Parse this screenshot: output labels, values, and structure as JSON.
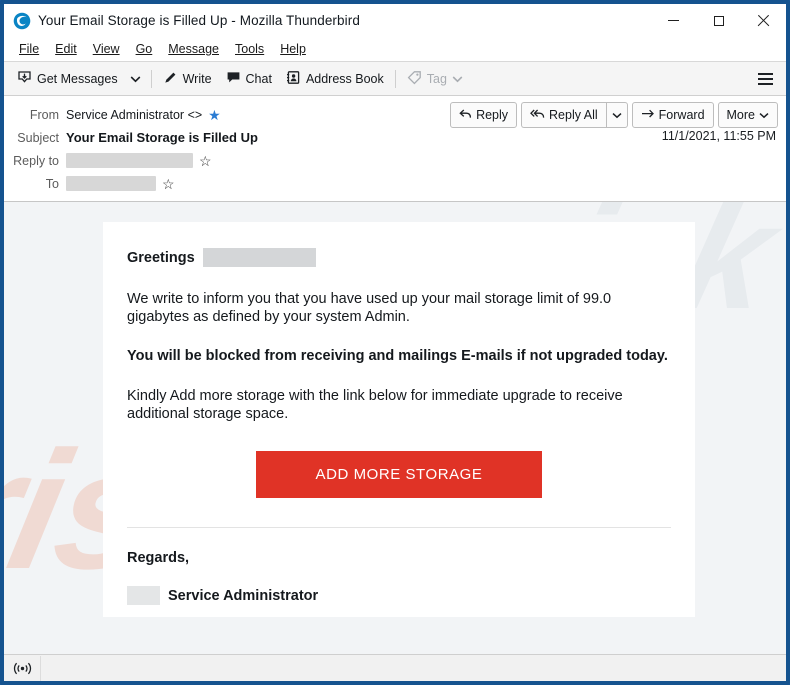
{
  "window": {
    "title": "Your Email Storage is Filled Up - Mozilla Thunderbird",
    "logo_icon": "thunderbird-logo-icon",
    "minimize_icon": "minimize-icon",
    "maximize_icon": "maximize-icon",
    "close_icon": "close-icon",
    "accent_color": "#15538f"
  },
  "menubar": {
    "items": [
      {
        "label": "File",
        "accel": "F"
      },
      {
        "label": "Edit",
        "accel": "E"
      },
      {
        "label": "View",
        "accel": "V"
      },
      {
        "label": "Go",
        "accel": "G"
      },
      {
        "label": "Message",
        "accel": "M"
      },
      {
        "label": "Tools",
        "accel": "T"
      },
      {
        "label": "Help",
        "accel": "H"
      }
    ]
  },
  "toolbar": {
    "get_messages": "Get Messages",
    "get_messages_icon": "download-inbox-icon",
    "get_messages_caret": "chevron-down-icon",
    "write": "Write",
    "write_icon": "pencil-icon",
    "chat": "Chat",
    "chat_icon": "speech-bubble-icon",
    "address_book": "Address Book",
    "address_book_icon": "address-book-icon",
    "tag": "Tag",
    "tag_icon": "tag-icon",
    "tag_caret": "chevron-down-icon",
    "tag_disabled": true,
    "app_menu_icon": "hamburger-menu-icon"
  },
  "message_header": {
    "from_label": "From",
    "from_value": "Service Administrator <>",
    "from_star_icon": "star-filled-icon",
    "subject_label": "Subject",
    "subject_value": "Your Email Storage is Filled Up",
    "reply_to_label": "Reply to",
    "reply_to_value": "",
    "reply_to_redacted": true,
    "reply_to_star_icon": "star-outline-icon",
    "to_label": "To",
    "to_value": "",
    "to_redacted": true,
    "to_star_icon": "star-outline-icon",
    "date": "11/1/2021, 11:55 PM",
    "actions": {
      "reply": "Reply",
      "reply_icon": "reply-arrow-icon",
      "reply_all": "Reply All",
      "reply_all_icon": "reply-all-arrow-icon",
      "reply_all_caret": "chevron-down-icon",
      "forward": "Forward",
      "forward_icon": "forward-arrow-icon",
      "more": "More",
      "more_caret": "chevron-down-icon"
    }
  },
  "email_body": {
    "watermark_top": "risk",
    "watermark_bottom": "risk.com",
    "watermark_color": "#e8562a",
    "greeting_label": "Greetings",
    "greeting_name_redacted": true,
    "paragraph_1": "We write to inform you that you have used up your mail storage limit of 99.0 gigabytes as defined by your system Admin.",
    "paragraph_2_bold": "You will be blocked from receiving and mailings E-mails if not upgraded today.",
    "paragraph_3": "Kindly Add more storage with the link below for immediate upgrade to receive additional storage space.",
    "cta_label": "ADD MORE STORAGE",
    "cta_color": "#e03326",
    "regards": "Regards,",
    "signature_name": "Service Administrator",
    "signature_redacted": true
  },
  "statusbar": {
    "icon": "broadcast-antenna-icon",
    "text": ""
  }
}
